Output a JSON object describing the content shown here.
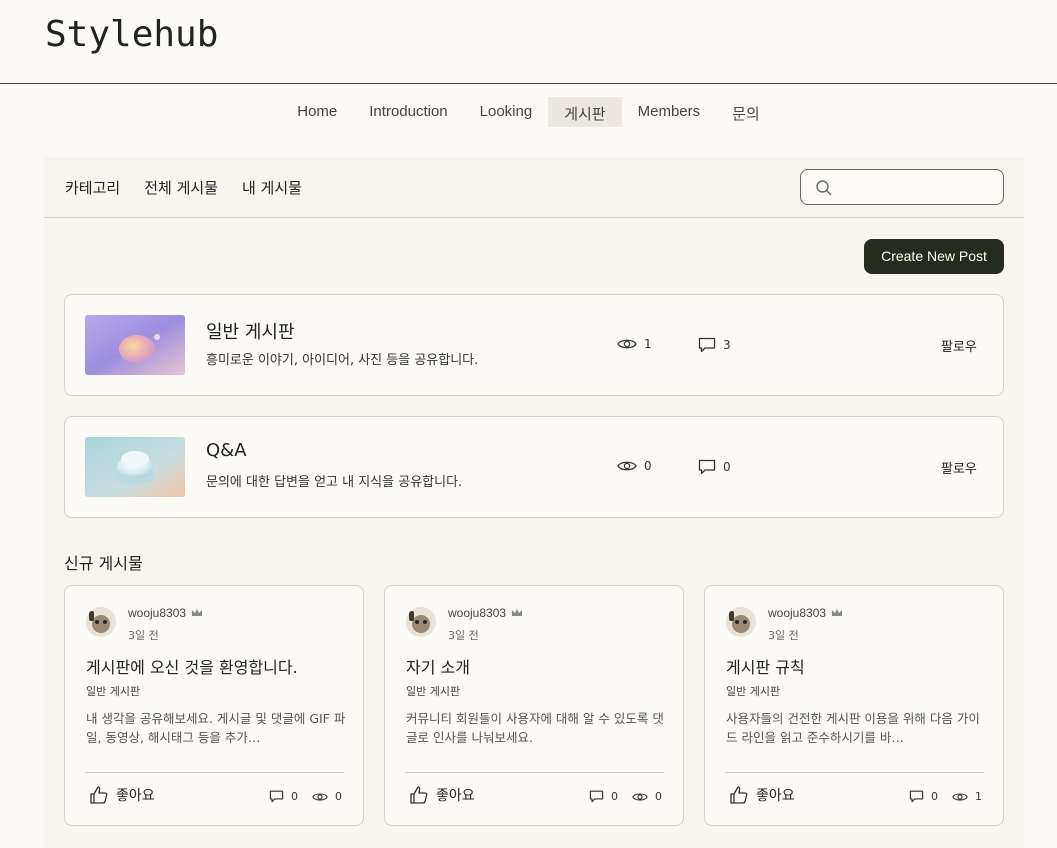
{
  "site": {
    "logo": "Stylehub"
  },
  "nav": {
    "items": [
      {
        "label": "Home",
        "active": false
      },
      {
        "label": "Introduction",
        "active": false
      },
      {
        "label": "Looking",
        "active": false
      },
      {
        "label": "게시판",
        "active": true
      },
      {
        "label": "Members",
        "active": false
      },
      {
        "label": "문의",
        "active": false
      }
    ]
  },
  "subnav": {
    "links": [
      "카테고리",
      "전체 게시물",
      "내 게시물"
    ],
    "search_placeholder": ""
  },
  "create_button": "Create New Post",
  "categories": [
    {
      "title": "일반 게시판",
      "description": "흥미로운 이야기, 아이디어, 사진 등을 공유합니다.",
      "views": "1",
      "comments": "3",
      "follow": "팔로우"
    },
    {
      "title": "Q&A",
      "description": "문의에 대한 답변을 얻고 내 지식을 공유합니다.",
      "views": "0",
      "comments": "0",
      "follow": "팔로우"
    }
  ],
  "new_posts": {
    "title": "신규 게시물",
    "posts": [
      {
        "author": "wooju8303",
        "time": "3일 전",
        "title": "게시판에 오신 것을 환영합니다.",
        "category": "일반 게시판",
        "excerpt": "내 생각을 공유해보세요. 게시글 및 댓글에 GIF 파일, 동영상, 해시태그 등을 추가…",
        "like_label": "좋아요",
        "comments": "0",
        "views": "0"
      },
      {
        "author": "wooju8303",
        "time": "3일 전",
        "title": "자기 소개",
        "category": "일반 게시판",
        "excerpt": "커뮤니티 회원들이 사용자에 대해 알 수 있도록 댓글로 인사를 나눠보세요.",
        "like_label": "좋아요",
        "comments": "0",
        "views": "0"
      },
      {
        "author": "wooju8303",
        "time": "3일 전",
        "title": "게시판 규칙",
        "category": "일반 게시판",
        "excerpt": "사용자들의 건전한 게시판 이용을 위해 다음 가이드 라인을 읽고 준수하시기를 바…",
        "like_label": "좋아요",
        "comments": "0",
        "views": "1"
      }
    ]
  },
  "colors": {
    "background": "#fcfaf6",
    "board": "#f8f5ef",
    "button": "#262c1d",
    "nav_active": "#ece7df"
  }
}
